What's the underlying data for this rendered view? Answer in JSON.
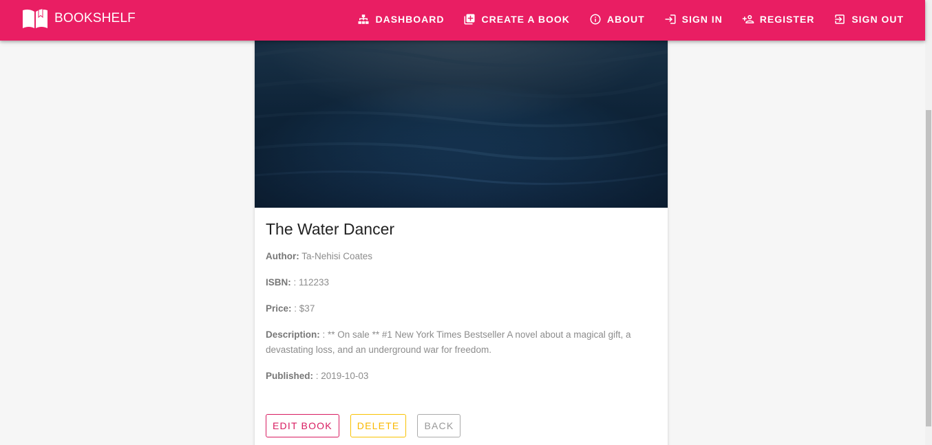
{
  "appbar": {
    "brand": "BOOKSHELF",
    "nav": [
      {
        "label": "DASHBOARD",
        "icon": "dashboard-icon"
      },
      {
        "label": "CREATE A BOOK",
        "icon": "plus-box-icon"
      },
      {
        "label": "ABOUT",
        "icon": "info-icon"
      },
      {
        "label": "SIGN IN",
        "icon": "login-icon"
      },
      {
        "label": "REGISTER",
        "icon": "person-add-icon"
      },
      {
        "label": "SIGN OUT",
        "icon": "logout-icon"
      }
    ],
    "color": "#e91e63"
  },
  "book": {
    "title": "The Water Dancer",
    "author_label": "Author:",
    "author": "Ta-Nehisi Coates",
    "isbn_label": "ISBN:",
    "isbn": ": 112233",
    "price_label": "Price:",
    "price": ": $37",
    "description_label": "Description:",
    "description": ": ** On sale ** #1 New York Times Bestseller A novel about a magical gift, a devastating loss, and an underground war for freedom.",
    "published_label": "Published:",
    "published": ": 2019-10-03"
  },
  "actions": {
    "edit": "EDIT BOOK",
    "delete": "DELETE",
    "back": "BACK"
  }
}
